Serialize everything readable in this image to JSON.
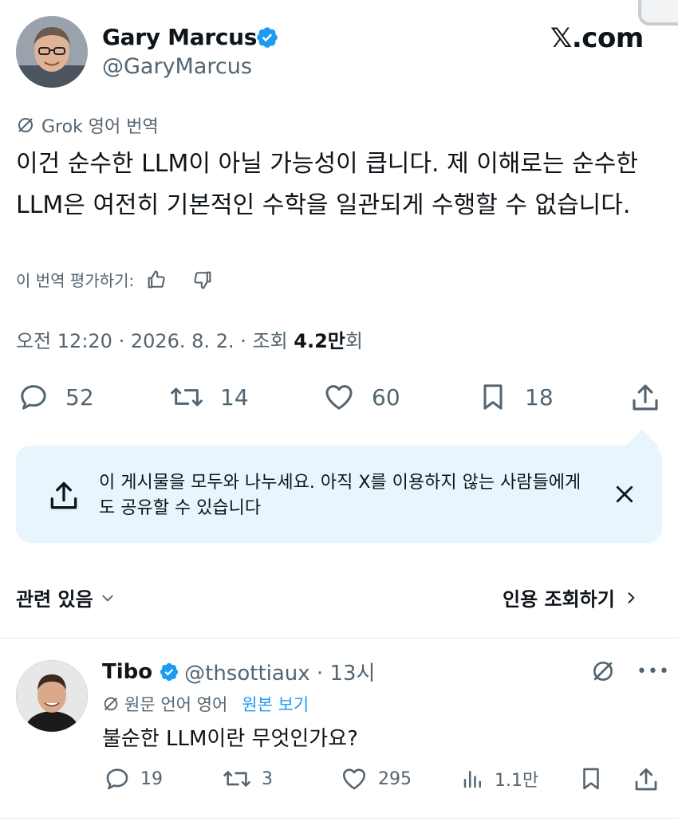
{
  "header": {
    "author_name": "Gary Marcus",
    "author_handle": "@GaryMarcus",
    "brand": "𝕏.com"
  },
  "translation": {
    "label": "Grok 영어 번역",
    "text": "이건 순수한 LLM이 아닐 가능성이 큽니다. 제 이해로는 순수한 LLM은 여전히 기본적인 수학을 일관되게 수행할 수 없습니다.",
    "rate_label": "이 번역 평가하기:"
  },
  "meta": {
    "time": "오전 12:20 · 2026. 8. 2. · 조회 ",
    "views_number": "4.2만",
    "views_suffix": "회"
  },
  "actions": {
    "replies": "52",
    "reposts": "14",
    "likes": "60",
    "bookmarks": "18"
  },
  "share_card": {
    "text": "이 게시물을 모두와 나누세요. 아직 X를 이용하지 않는 사람들에게도 공유할 수 있습니다"
  },
  "related": {
    "label": "관련 있음",
    "quotes_label": "인용 조회하기"
  },
  "reply": {
    "name": "Tibo",
    "handle": "@thsottiaux · 13시",
    "lang_label": "원문 언어 영어",
    "show_original": "원본 보기",
    "text": "불순한 LLM이란 무엇인가요?",
    "replies": "19",
    "reposts": "3",
    "likes": "295",
    "views": "1.1만"
  },
  "colors": {
    "accent": "#1d9bf0",
    "text": "#0f1419",
    "muted": "#536471",
    "share_bg": "#e8f5fd"
  }
}
